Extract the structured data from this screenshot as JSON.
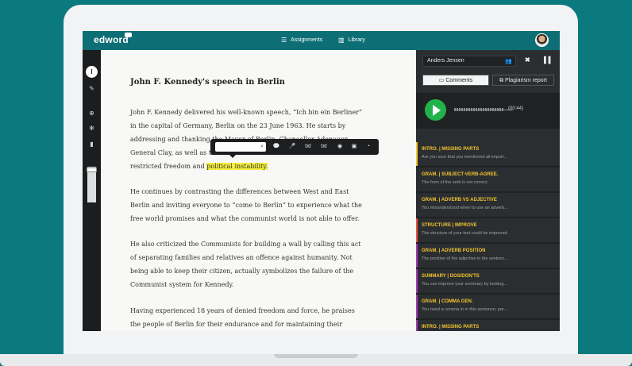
{
  "app": {
    "logo": "edword"
  },
  "nav": {
    "assignments_icon": "list-icon",
    "assignments": "Assignments",
    "library_icon": "book-icon",
    "library": "Library"
  },
  "tools": [
    "cursor-icon",
    "pen-icon",
    "zoom-icon",
    "gear-icon",
    "trash-icon"
  ],
  "document": {
    "title": "John F. Kennedy's speech in Berlin",
    "p1": {
      "l1": "John F. Kennedy delivered his well-known speech, “Ich bin ein Berliner”",
      "l2": "in the capital of Germany, Berlin on the 23 June 1963. He starts by",
      "l3": "addressing and thanking the Mayor of Berlin, Chancellor Adenauer,",
      "l4": "General Clay, as well as the citizens of Berlin who live in a state of",
      "l5_pre": "restricted freedom and ",
      "l5_hl": "political instability."
    },
    "p2": {
      "l1": "He continues by contrasting the differences between West and East",
      "l2": "Berlin and inviting everyone to “come to Berlin” to experience what the",
      "l3": "free world promises and what the communist world is not able to offer."
    },
    "p3": {
      "l1": "He also criticized the Communists for building a wall by calling this act",
      "l2": "of separating families and relatives an offence against humanity. Not",
      "l3": "being able to keep their citizen, actually symbolizes the failure of the",
      "l4": "Communist system for Kennedy."
    },
    "p4": {
      "l1": "Having experienced 18 years of denied freedom and force, he praises",
      "l2": "the people of Berlin for their endurance and for maintaining their"
    }
  },
  "toolbar": {
    "search_icon": "magnifier-icon",
    "buttons": [
      "💬",
      "🎤",
      "txt",
      "txt",
      "◉",
      "▣",
      "◔"
    ]
  },
  "panel": {
    "user": "Anders Jensen",
    "tabs": {
      "comments": "Comments",
      "plagiarism": "Plagiarism report"
    },
    "audio_time": "00:44",
    "comments": [
      {
        "type": "INTRO.",
        "title": "MISSING PARTS",
        "text": "Are you sure that you mentioned all import...",
        "color": "#f2c431"
      },
      {
        "type": "GRAM.",
        "title": "SUBJECT-VERB-AGREE.",
        "text": "The form of the verb is not correct.",
        "color": "#2b2e30"
      },
      {
        "type": "GRAM.",
        "title": "ADVERB VS ADJECTIVE",
        "text": "You misunderstood when to use an adverb...",
        "color": "#2b2e30"
      },
      {
        "type": "STRUCTURE",
        "title": "IMPROVE",
        "text": "The structure of your text could be improved.",
        "color": "#e8553e"
      },
      {
        "type": "GRAM.",
        "title": "ADVERB POSITION",
        "text": "The position of the adjective in the sentenc...",
        "color": "#a23bb5"
      },
      {
        "type": "SUMMARY",
        "title": "DOS/DON'TS",
        "text": "You can improve your summary by looking...",
        "color": "#a23bb5"
      },
      {
        "type": "GRAM.",
        "title": "COMMA GEN.",
        "text": "You need a comma in in this sentence; par...",
        "color": "#a23bb5"
      },
      {
        "type": "INTRO.",
        "title": "MISSING PARTS",
        "text": "",
        "color": "#a23bb5"
      }
    ]
  }
}
